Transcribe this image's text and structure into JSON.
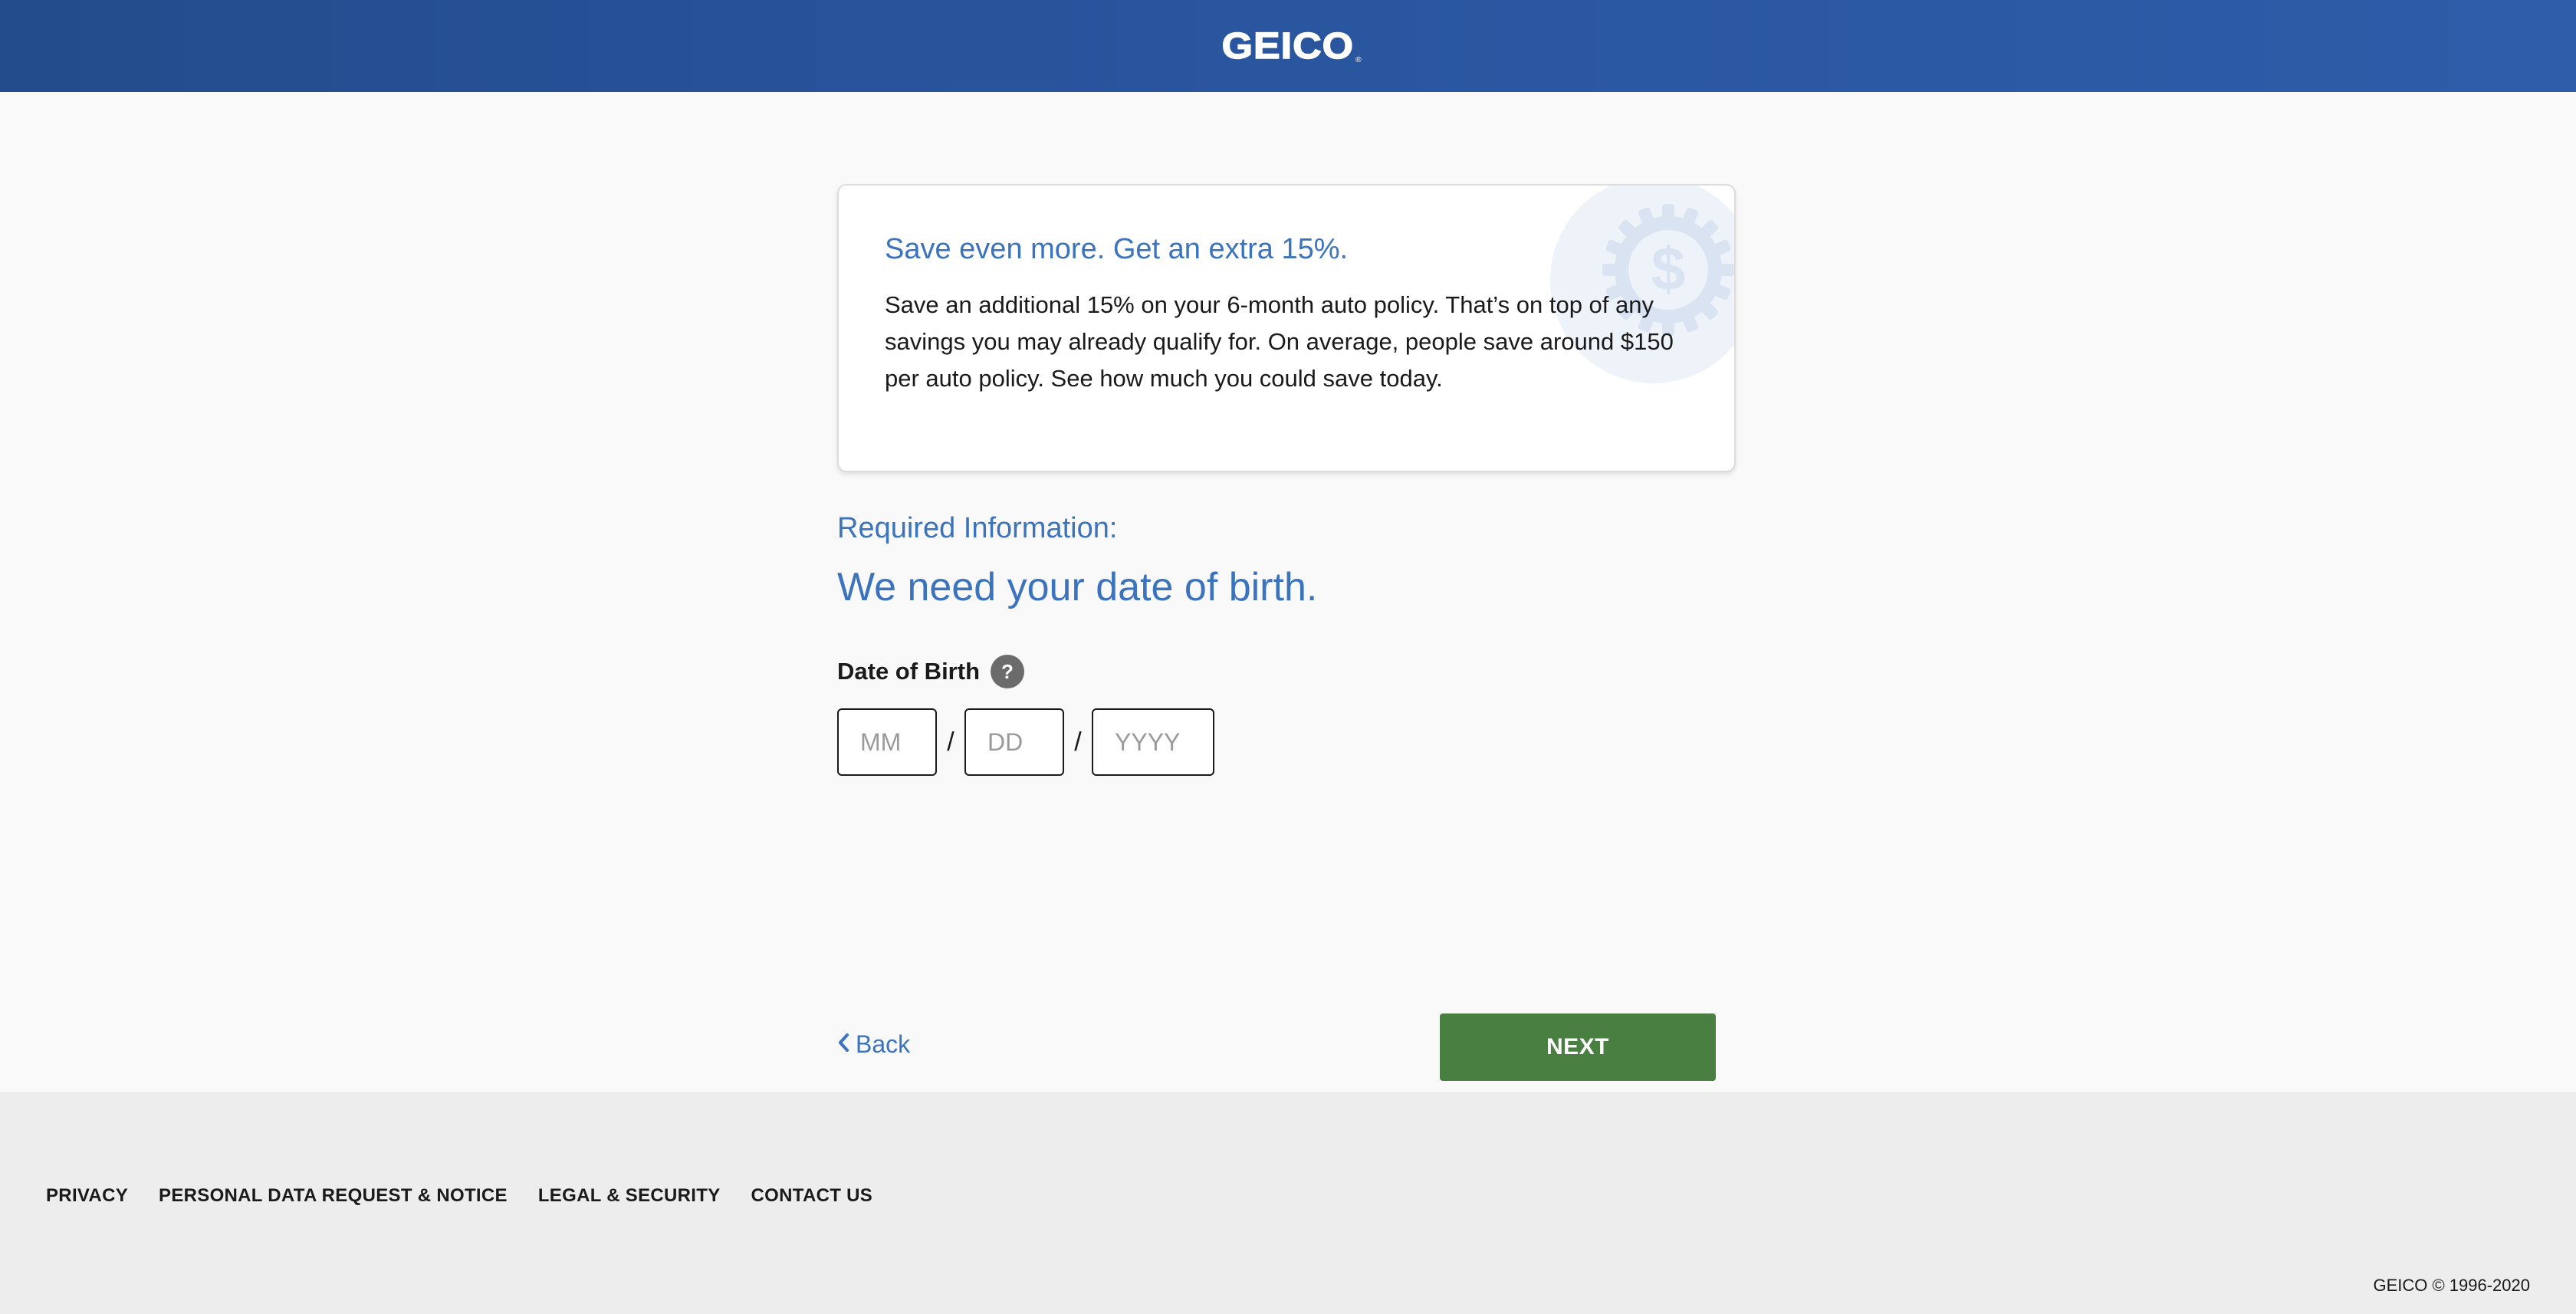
{
  "header": {
    "logo_text": "GEICO",
    "logo_mark": "®"
  },
  "promo": {
    "title": "Save even more. Get an extra 15%.",
    "body": "Save an additional 15% on your 6-month auto policy. That’s on top of any savings you may already qualify for. On average, people save around $150 per auto policy. See how much you could save today.",
    "icon": "dollar-gear-badge-icon"
  },
  "form": {
    "required_label": "Required Information:",
    "heading": "We need your date of birth.",
    "dob_label": "Date of Birth",
    "help_icon_glyph": "?",
    "month": {
      "value": "",
      "placeholder": "MM"
    },
    "day": {
      "value": "",
      "placeholder": "DD"
    },
    "year": {
      "value": "",
      "placeholder": "YYYY"
    },
    "separator": "/"
  },
  "nav": {
    "back_label": "Back",
    "next_label": "NEXT"
  },
  "footer": {
    "links": [
      "PRIVACY",
      "PERSONAL DATA REQUEST & NOTICE",
      "LEGAL & SECURITY",
      "CONTACT US"
    ],
    "copyright": "GEICO © 1996-2020"
  },
  "colors": {
    "header_blue": "#2a56a0",
    "accent_blue": "#3b73bd",
    "next_green": "#4a7f42",
    "footer_bg": "#ededed",
    "page_bg": "#f9f9f9"
  }
}
